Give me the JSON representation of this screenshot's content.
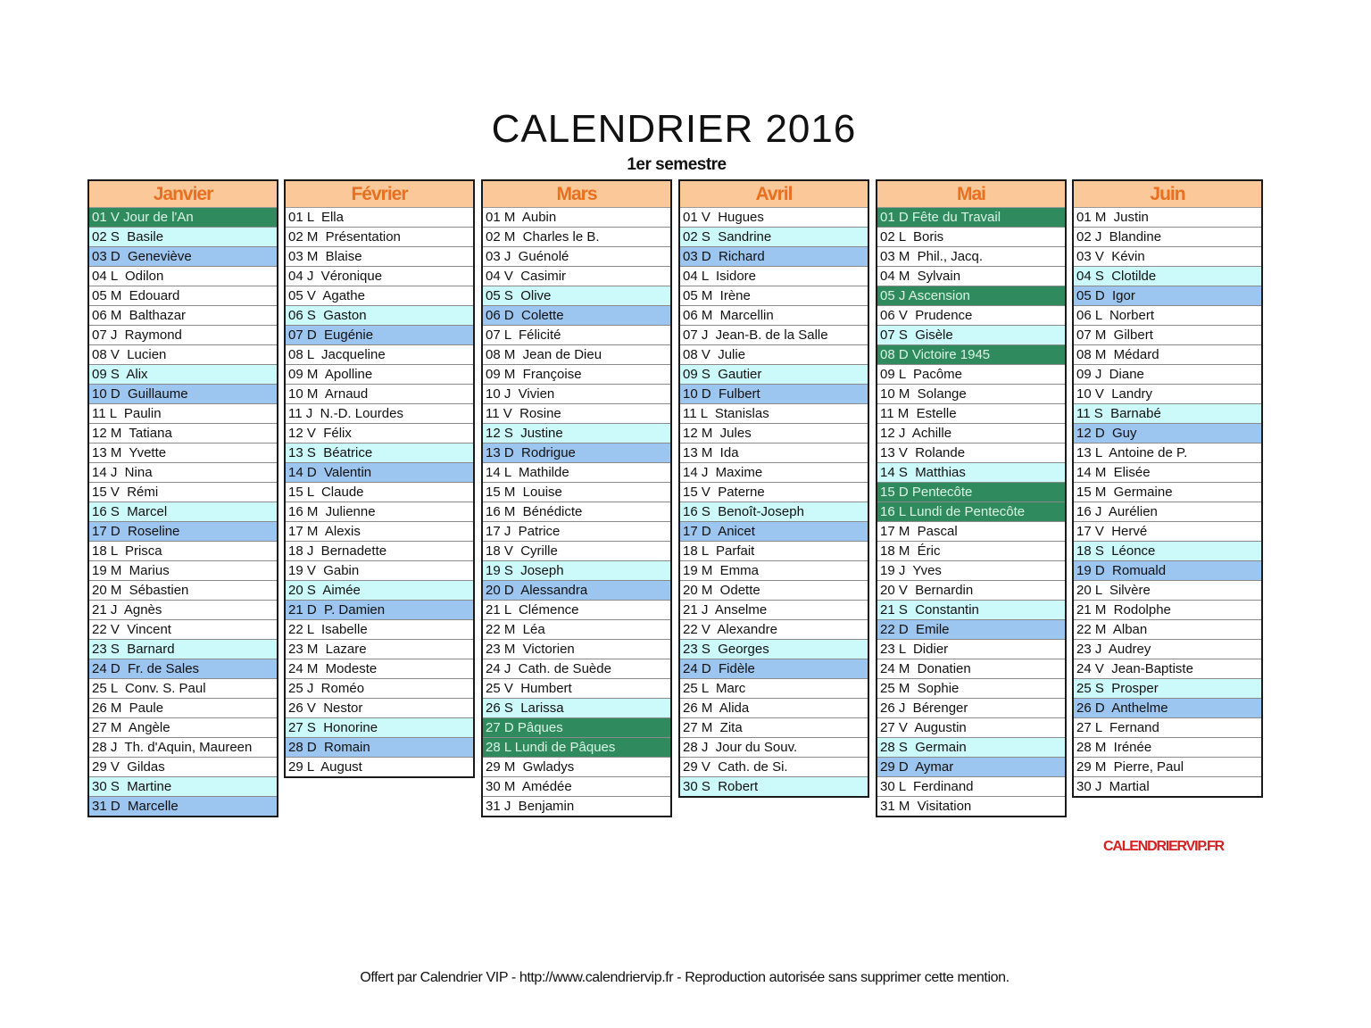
{
  "title": "CALENDRIER 2016",
  "subtitle": "1er semestre",
  "brand": "CALENDRIERVIP.FR",
  "footer": "Offert par Calendrier VIP - http://www.calendriervip.fr - Reproduction autorisée sans supprimer cette mention.",
  "colors": {
    "header_bg": "#fbc89a",
    "header_text": "#e8701f",
    "saturday_bg": "#ccfafa",
    "sunday_bg": "#9cc5f0",
    "holiday_bg": "#2f8a5d",
    "brand": "#d42121"
  },
  "months": [
    {
      "name": "Janvier",
      "days": [
        {
          "text": "01 V Jour de l'An",
          "type": "holiday"
        },
        {
          "text": "02 S  Basile",
          "type": "sat"
        },
        {
          "text": "03 D  Geneviève",
          "type": "sun"
        },
        {
          "text": "04 L  Odilon",
          "type": ""
        },
        {
          "text": "05 M  Edouard",
          "type": ""
        },
        {
          "text": "06 M  Balthazar",
          "type": ""
        },
        {
          "text": "07 J  Raymond",
          "type": ""
        },
        {
          "text": "08 V  Lucien",
          "type": ""
        },
        {
          "text": "09 S  Alix",
          "type": "sat"
        },
        {
          "text": "10 D  Guillaume",
          "type": "sun"
        },
        {
          "text": "11 L  Paulin",
          "type": ""
        },
        {
          "text": "12 M  Tatiana",
          "type": ""
        },
        {
          "text": "13 M  Yvette",
          "type": ""
        },
        {
          "text": "14 J  Nina",
          "type": ""
        },
        {
          "text": "15 V  Rémi",
          "type": ""
        },
        {
          "text": "16 S  Marcel",
          "type": "sat"
        },
        {
          "text": "17 D  Roseline",
          "type": "sun"
        },
        {
          "text": "18 L  Prisca",
          "type": ""
        },
        {
          "text": "19 M  Marius",
          "type": ""
        },
        {
          "text": "20 M  Sébastien",
          "type": ""
        },
        {
          "text": "21 J  Agnès",
          "type": ""
        },
        {
          "text": "22 V  Vincent",
          "type": ""
        },
        {
          "text": "23 S  Barnard",
          "type": "sat"
        },
        {
          "text": "24 D  Fr. de Sales",
          "type": "sun"
        },
        {
          "text": "25 L  Conv. S. Paul",
          "type": ""
        },
        {
          "text": "26 M  Paule",
          "type": ""
        },
        {
          "text": "27 M  Angèle",
          "type": ""
        },
        {
          "text": "28 J  Th. d'Aquin, Maureen",
          "type": ""
        },
        {
          "text": "29 V  Gildas",
          "type": ""
        },
        {
          "text": "30 S  Martine",
          "type": "sat"
        },
        {
          "text": "31 D  Marcelle",
          "type": "sun"
        }
      ]
    },
    {
      "name": "Février",
      "days": [
        {
          "text": "01 L  Ella",
          "type": ""
        },
        {
          "text": "02 M  Présentation",
          "type": ""
        },
        {
          "text": "03 M  Blaise",
          "type": ""
        },
        {
          "text": "04 J  Véronique",
          "type": ""
        },
        {
          "text": "05 V  Agathe",
          "type": ""
        },
        {
          "text": "06 S  Gaston",
          "type": "sat"
        },
        {
          "text": "07 D  Eugénie",
          "type": "sun"
        },
        {
          "text": "08 L  Jacqueline",
          "type": ""
        },
        {
          "text": "09 M  Apolline",
          "type": ""
        },
        {
          "text": "10 M  Arnaud",
          "type": ""
        },
        {
          "text": "11 J  N.-D. Lourdes",
          "type": ""
        },
        {
          "text": "12 V  Félix",
          "type": ""
        },
        {
          "text": "13 S  Béatrice",
          "type": "sat"
        },
        {
          "text": "14 D  Valentin",
          "type": "sun"
        },
        {
          "text": "15 L  Claude",
          "type": ""
        },
        {
          "text": "16 M  Julienne",
          "type": ""
        },
        {
          "text": "17 M  Alexis",
          "type": ""
        },
        {
          "text": "18 J  Bernadette",
          "type": ""
        },
        {
          "text": "19 V  Gabin",
          "type": ""
        },
        {
          "text": "20 S  Aimée",
          "type": "sat"
        },
        {
          "text": "21 D  P. Damien",
          "type": "sun"
        },
        {
          "text": "22 L  Isabelle",
          "type": ""
        },
        {
          "text": "23 M  Lazare",
          "type": ""
        },
        {
          "text": "24 M  Modeste",
          "type": ""
        },
        {
          "text": "25 J  Roméo",
          "type": ""
        },
        {
          "text": "26 V  Nestor",
          "type": ""
        },
        {
          "text": "27 S  Honorine",
          "type": "sat"
        },
        {
          "text": "28 D  Romain",
          "type": "sun"
        },
        {
          "text": "29 L  August",
          "type": ""
        }
      ]
    },
    {
      "name": "Mars",
      "days": [
        {
          "text": "01 M  Aubin",
          "type": ""
        },
        {
          "text": "02 M  Charles le B.",
          "type": ""
        },
        {
          "text": "03 J  Guénolé",
          "type": ""
        },
        {
          "text": "04 V  Casimir",
          "type": ""
        },
        {
          "text": "05 S  Olive",
          "type": "sat"
        },
        {
          "text": "06 D  Colette",
          "type": "sun"
        },
        {
          "text": "07 L  Félicité",
          "type": ""
        },
        {
          "text": "08 M  Jean de Dieu",
          "type": ""
        },
        {
          "text": "09 M  Françoise",
          "type": ""
        },
        {
          "text": "10 J  Vivien",
          "type": ""
        },
        {
          "text": "11 V  Rosine",
          "type": ""
        },
        {
          "text": "12 S  Justine",
          "type": "sat"
        },
        {
          "text": "13 D  Rodrigue",
          "type": "sun"
        },
        {
          "text": "14 L  Mathilde",
          "type": ""
        },
        {
          "text": "15 M  Louise",
          "type": ""
        },
        {
          "text": "16 M  Bénédicte",
          "type": ""
        },
        {
          "text": "17 J  Patrice",
          "type": ""
        },
        {
          "text": "18 V  Cyrille",
          "type": ""
        },
        {
          "text": "19 S  Joseph",
          "type": "sat"
        },
        {
          "text": "20 D  Alessandra",
          "type": "sun"
        },
        {
          "text": "21 L  Clémence",
          "type": ""
        },
        {
          "text": "22 M  Léa",
          "type": ""
        },
        {
          "text": "23 M  Victorien",
          "type": ""
        },
        {
          "text": "24 J  Cath. de Suède",
          "type": ""
        },
        {
          "text": "25 V  Humbert",
          "type": ""
        },
        {
          "text": "26 S  Larissa",
          "type": "sat"
        },
        {
          "text": "27 D Pâques",
          "type": "holiday"
        },
        {
          "text": "28 L Lundi de Pâques",
          "type": "holiday"
        },
        {
          "text": "29 M  Gwladys",
          "type": ""
        },
        {
          "text": "30 M  Amédée",
          "type": ""
        },
        {
          "text": "31 J  Benjamin",
          "type": ""
        }
      ]
    },
    {
      "name": "Avril",
      "days": [
        {
          "text": "01 V  Hugues",
          "type": ""
        },
        {
          "text": "02 S  Sandrine",
          "type": "sat"
        },
        {
          "text": "03 D  Richard",
          "type": "sun"
        },
        {
          "text": "04 L  Isidore",
          "type": ""
        },
        {
          "text": "05 M  Irène",
          "type": ""
        },
        {
          "text": "06 M  Marcellin",
          "type": ""
        },
        {
          "text": "07 J  Jean-B. de la Salle",
          "type": ""
        },
        {
          "text": "08 V  Julie",
          "type": ""
        },
        {
          "text": "09 S  Gautier",
          "type": "sat"
        },
        {
          "text": "10 D  Fulbert",
          "type": "sun"
        },
        {
          "text": "11 L  Stanislas",
          "type": ""
        },
        {
          "text": "12 M  Jules",
          "type": ""
        },
        {
          "text": "13 M  Ida",
          "type": ""
        },
        {
          "text": "14 J  Maxime",
          "type": ""
        },
        {
          "text": "15 V  Paterne",
          "type": ""
        },
        {
          "text": "16 S  Benoît-Joseph",
          "type": "sat"
        },
        {
          "text": "17 D  Anicet",
          "type": "sun"
        },
        {
          "text": "18 L  Parfait",
          "type": ""
        },
        {
          "text": "19 M  Emma",
          "type": ""
        },
        {
          "text": "20 M  Odette",
          "type": ""
        },
        {
          "text": "21 J  Anselme",
          "type": ""
        },
        {
          "text": "22 V  Alexandre",
          "type": ""
        },
        {
          "text": "23 S  Georges",
          "type": "sat"
        },
        {
          "text": "24 D  Fidèle",
          "type": "sun"
        },
        {
          "text": "25 L  Marc",
          "type": ""
        },
        {
          "text": "26 M  Alida",
          "type": ""
        },
        {
          "text": "27 M  Zita",
          "type": ""
        },
        {
          "text": "28 J  Jour du Souv.",
          "type": ""
        },
        {
          "text": "29 V  Cath. de Si.",
          "type": ""
        },
        {
          "text": "30 S  Robert",
          "type": "sat"
        }
      ]
    },
    {
      "name": "Mai",
      "days": [
        {
          "text": "01 D Fête du Travail",
          "type": "holiday"
        },
        {
          "text": "02 L  Boris",
          "type": ""
        },
        {
          "text": "03 M  Phil., Jacq.",
          "type": ""
        },
        {
          "text": "04 M  Sylvain",
          "type": ""
        },
        {
          "text": "05 J Ascension",
          "type": "holiday"
        },
        {
          "text": "06 V  Prudence",
          "type": ""
        },
        {
          "text": "07 S  Gisèle",
          "type": "sat"
        },
        {
          "text": "08 D Victoire 1945",
          "type": "holiday"
        },
        {
          "text": "09 L  Pacôme",
          "type": ""
        },
        {
          "text": "10 M  Solange",
          "type": ""
        },
        {
          "text": "11 M  Estelle",
          "type": ""
        },
        {
          "text": "12 J  Achille",
          "type": ""
        },
        {
          "text": "13 V  Rolande",
          "type": ""
        },
        {
          "text": "14 S  Matthias",
          "type": "sat"
        },
        {
          "text": "15 D Pentecôte",
          "type": "holiday"
        },
        {
          "text": "16 L Lundi de Pentecôte",
          "type": "holiday"
        },
        {
          "text": "17 M  Pascal",
          "type": ""
        },
        {
          "text": "18 M  Éric",
          "type": ""
        },
        {
          "text": "19 J  Yves",
          "type": ""
        },
        {
          "text": "20 V  Bernardin",
          "type": ""
        },
        {
          "text": "21 S  Constantin",
          "type": "sat"
        },
        {
          "text": "22 D  Emile",
          "type": "sun"
        },
        {
          "text": "23 L  Didier",
          "type": ""
        },
        {
          "text": "24 M  Donatien",
          "type": ""
        },
        {
          "text": "25 M  Sophie",
          "type": ""
        },
        {
          "text": "26 J  Bérenger",
          "type": ""
        },
        {
          "text": "27 V  Augustin",
          "type": ""
        },
        {
          "text": "28 S  Germain",
          "type": "sat"
        },
        {
          "text": "29 D  Aymar",
          "type": "sun"
        },
        {
          "text": "30 L  Ferdinand",
          "type": ""
        },
        {
          "text": "31 M  Visitation",
          "type": ""
        }
      ]
    },
    {
      "name": "Juin",
      "days": [
        {
          "text": "01 M  Justin",
          "type": ""
        },
        {
          "text": "02 J  Blandine",
          "type": ""
        },
        {
          "text": "03 V  Kévin",
          "type": ""
        },
        {
          "text": "04 S  Clotilde",
          "type": "sat"
        },
        {
          "text": "05 D  Igor",
          "type": "sun"
        },
        {
          "text": "06 L  Norbert",
          "type": ""
        },
        {
          "text": "07 M  Gilbert",
          "type": ""
        },
        {
          "text": "08 M  Médard",
          "type": ""
        },
        {
          "text": "09 J  Diane",
          "type": ""
        },
        {
          "text": "10 V  Landry",
          "type": ""
        },
        {
          "text": "11 S  Barnabé",
          "type": "sat"
        },
        {
          "text": "12 D  Guy",
          "type": "sun"
        },
        {
          "text": "13 L  Antoine de P.",
          "type": ""
        },
        {
          "text": "14 M  Elisée",
          "type": ""
        },
        {
          "text": "15 M  Germaine",
          "type": ""
        },
        {
          "text": "16 J  Aurélien",
          "type": ""
        },
        {
          "text": "17 V  Hervé",
          "type": ""
        },
        {
          "text": "18 S  Léonce",
          "type": "sat"
        },
        {
          "text": "19 D  Romuald",
          "type": "sun"
        },
        {
          "text": "20 L  Silvère",
          "type": ""
        },
        {
          "text": "21 M  Rodolphe",
          "type": ""
        },
        {
          "text": "22 M  Alban",
          "type": ""
        },
        {
          "text": "23 J  Audrey",
          "type": ""
        },
        {
          "text": "24 V  Jean-Baptiste",
          "type": ""
        },
        {
          "text": "25 S  Prosper",
          "type": "sat"
        },
        {
          "text": "26 D  Anthelme",
          "type": "sun"
        },
        {
          "text": "27 L  Fernand",
          "type": ""
        },
        {
          "text": "28 M  Irénée",
          "type": ""
        },
        {
          "text": "29 M  Pierre, Paul",
          "type": ""
        },
        {
          "text": "30 J  Martial",
          "type": ""
        }
      ]
    }
  ]
}
